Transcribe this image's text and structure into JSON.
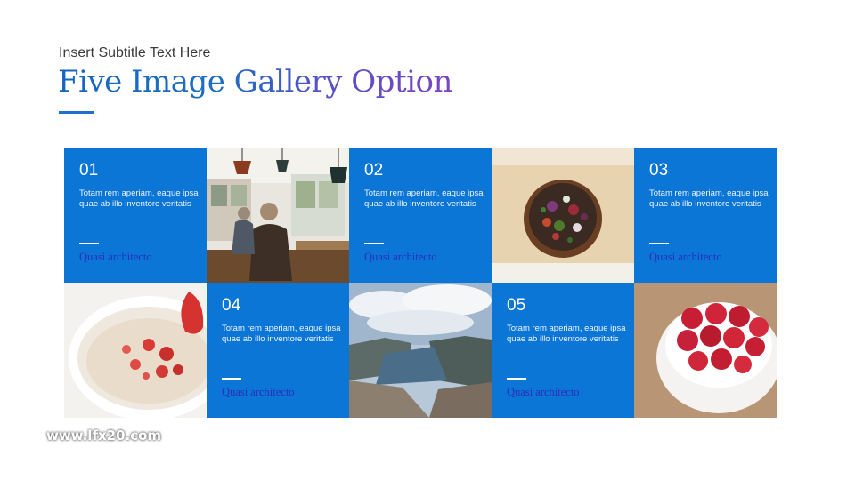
{
  "header": {
    "subtitle": "Insert Subtitle Text Here",
    "title": "Five Image Gallery Option"
  },
  "accent_color": "#0b76d6",
  "link_color": "#2a2fb8",
  "cards": [
    {
      "number": "01",
      "description": "Totam rem aperiam, eaque ipsa quae ab illo inventore veritatis",
      "link": "Quasi architecto"
    },
    {
      "number": "02",
      "description": "Totam rem aperiam, eaque ipsa quae ab illo inventore veritatis",
      "link": "Quasi architecto"
    },
    {
      "number": "03",
      "description": "Totam rem aperiam, eaque ipsa quae ab illo inventore veritatis",
      "link": "Quasi architecto"
    },
    {
      "number": "04",
      "description": "Totam rem aperiam, eaque ipsa quae ab illo inventore veritatis",
      "link": "Quasi architecto"
    },
    {
      "number": "05",
      "description": "Totam rem aperiam, eaque ipsa quae ab illo inventore veritatis",
      "link": "Quasi architecto"
    }
  ],
  "watermark": "www.lfx20.com"
}
